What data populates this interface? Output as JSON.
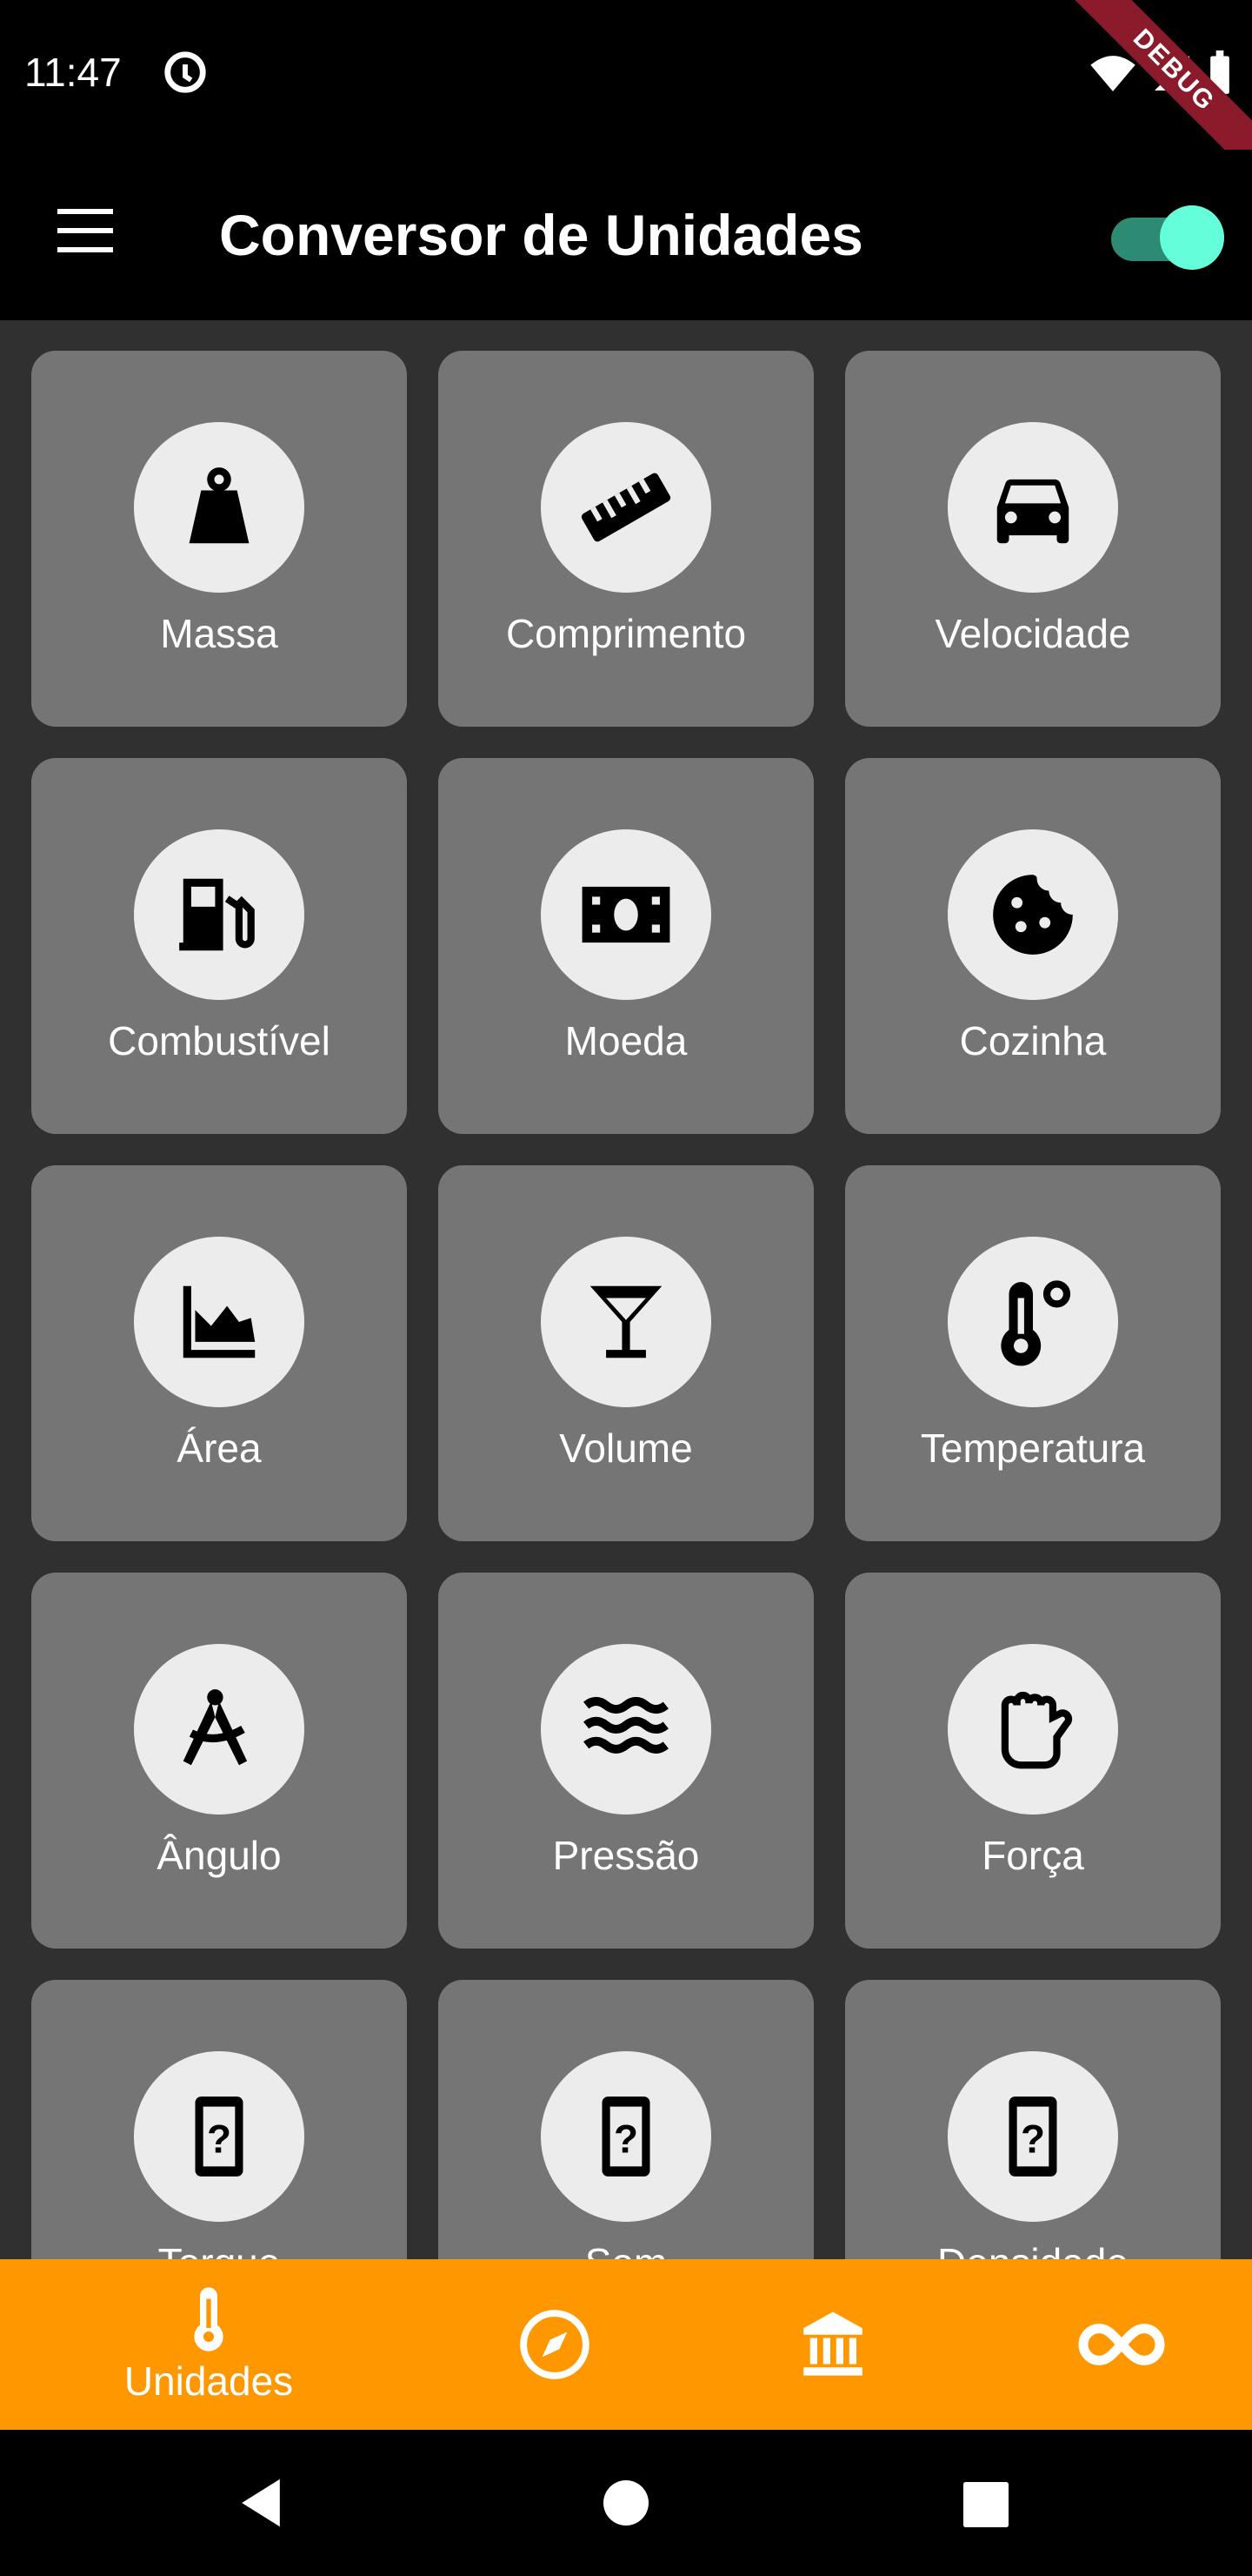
{
  "status_bar": {
    "time": "11:47",
    "debug": "DEBUG"
  },
  "app_bar": {
    "title": "Conversor de Unidades",
    "toggle_on": true
  },
  "categories": [
    {
      "label": "Massa",
      "icon": "weight-icon"
    },
    {
      "label": "Comprimento",
      "icon": "ruler-icon"
    },
    {
      "label": "Velocidade",
      "icon": "car-icon"
    },
    {
      "label": "Combustível",
      "icon": "fuel-pump-icon"
    },
    {
      "label": "Moeda",
      "icon": "banknote-icon"
    },
    {
      "label": "Cozinha",
      "icon": "cookie-icon"
    },
    {
      "label": "Área",
      "icon": "area-chart-icon"
    },
    {
      "label": "Volume",
      "icon": "cocktail-glass-icon"
    },
    {
      "label": "Temperatura",
      "icon": "thermometer-celsius-icon"
    },
    {
      "label": "Ângulo",
      "icon": "compass-drawing-icon"
    },
    {
      "label": "Pressão",
      "icon": "waves-icon"
    },
    {
      "label": "Força",
      "icon": "fist-icon"
    },
    {
      "label": "Torque",
      "icon": "device-unknown-icon"
    },
    {
      "label": "Som",
      "icon": "device-unknown-icon"
    },
    {
      "label": "Densidade",
      "icon": "device-unknown-icon"
    }
  ],
  "bottom_nav": {
    "items": [
      {
        "label": "Unidades",
        "icon": "thermometer-icon",
        "active": true
      },
      {
        "label": "",
        "icon": "compass-icon"
      },
      {
        "label": "",
        "icon": "bank-icon"
      },
      {
        "label": "",
        "icon": "infinity-icon"
      }
    ]
  },
  "colors": {
    "background": "#303030",
    "card": "#757575",
    "icon_circle": "#ececec",
    "bottom_nav": "#ff9800",
    "toggle_knob": "#64ffda"
  }
}
